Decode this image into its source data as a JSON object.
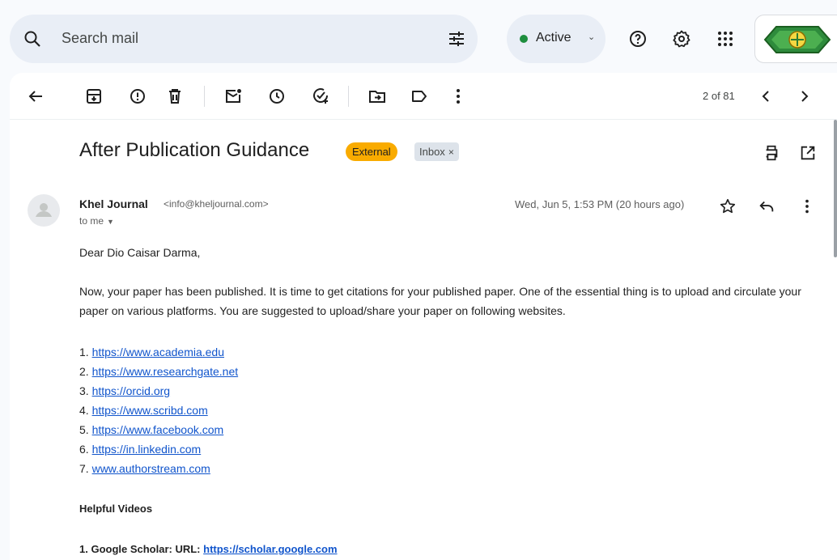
{
  "search": {
    "placeholder": "Search mail"
  },
  "status": {
    "label": "Active"
  },
  "toolbar": {
    "pager": "2 of 81"
  },
  "email": {
    "subject": "After Publication Guidance",
    "labels": {
      "external": "External",
      "inbox": "Inbox"
    },
    "sender_name": "Khel Journal",
    "sender_email": "<info@kheljournal.com>",
    "recipient": "to me",
    "date": "Wed, Jun 5, 1:53 PM (20 hours ago)",
    "greeting": "Dear Dio Caisar Darma,",
    "paragraph": "Now, your paper has been published. It is time to get citations for your published paper. One of the essential thing is to upload and circulate your paper on various platforms. You are suggested to upload/share your paper on following websites.",
    "links": [
      {
        "num": "1.",
        "url": "https://www.academia.edu"
      },
      {
        "num": "2.",
        "url": "https://www.researchgate.net"
      },
      {
        "num": "3.",
        "url": "https://orcid.org"
      },
      {
        "num": "4.",
        "url": "https://www.scribd.com"
      },
      {
        "num": "5.",
        "url": "https://www.facebook.com"
      },
      {
        "num": "6.",
        "url": "https://in.linkedin.com"
      },
      {
        "num": "7.",
        "url": "www.authorstream.com"
      }
    ],
    "helpful_heading": "Helpful Videos",
    "video_item": {
      "label": "1. Google Scholar: URL: ",
      "url": "https://scholar.google.com"
    }
  },
  "colors": {
    "status_active": "#1e8e3e",
    "external_label": "#f9ab00",
    "link": "#1155cc"
  }
}
